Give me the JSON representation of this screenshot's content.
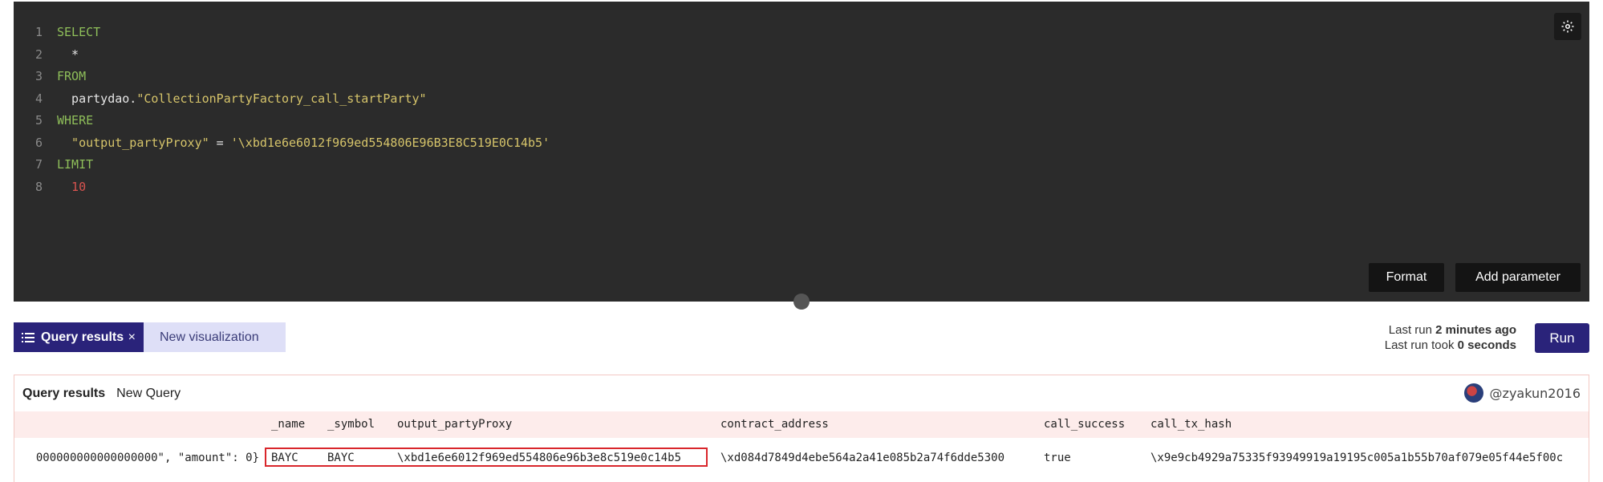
{
  "editor": {
    "lines": [
      {
        "no": "1",
        "tokens": [
          {
            "t": "SELECT",
            "c": "kw"
          }
        ]
      },
      {
        "no": "2",
        "tokens": [
          {
            "t": "  *",
            "c": "plain"
          }
        ]
      },
      {
        "no": "3",
        "tokens": [
          {
            "t": "FROM",
            "c": "kw"
          }
        ]
      },
      {
        "no": "4",
        "tokens": [
          {
            "t": "  partydao.",
            "c": "plain"
          },
          {
            "t": "\"CollectionPartyFactory_call_startParty\"",
            "c": "str"
          }
        ]
      },
      {
        "no": "5",
        "tokens": [
          {
            "t": "WHERE",
            "c": "kw"
          }
        ]
      },
      {
        "no": "6",
        "tokens": [
          {
            "t": "  \"output_partyProxy\"",
            "c": "str"
          },
          {
            "t": " = ",
            "c": "plain"
          },
          {
            "t": "'\\xbd1e6e6012f969ed554806E96B3E8C519E0C14b5'",
            "c": "str"
          }
        ]
      },
      {
        "no": "7",
        "tokens": [
          {
            "t": "LIMIT",
            "c": "kw"
          }
        ]
      },
      {
        "no": "8",
        "tokens": [
          {
            "t": "  10",
            "c": "num"
          }
        ]
      }
    ],
    "format_label": "Format",
    "add_parameter_label": "Add parameter",
    "settings_icon": "gear-icon"
  },
  "tabs": {
    "query_results": "Query results",
    "close": "×",
    "new_visualization": "New visualization"
  },
  "run": {
    "last_run_prefix": "Last run ",
    "last_run_value": "2 minutes ago",
    "took_prefix": "Last run took ",
    "took_value": "0 seconds",
    "label": "Run"
  },
  "results": {
    "title": "Query results",
    "query_name": "New Query",
    "user": "@zyakun2016",
    "columns": [
      "_name",
      "_symbol",
      "output_partyProxy",
      "contract_address",
      "call_success",
      "call_tx_hash"
    ],
    "row": {
      "truncated": "000000000000000000\", \"amount\": 0}",
      "_name": "BAYC",
      "_symbol": "BAYC",
      "output_partyProxy": "\\xbd1e6e6012f969ed554806e96b3e8c519e0c14b5",
      "contract_address": "\\xd084d7849d4ebe564a2a41e085b2a74f6dde5300",
      "call_success": "true",
      "call_tx_hash": "\\x9e9cb4929a75335f93949919a19195c005a1b55b70af079e05f44e5f00c"
    }
  },
  "colors": {
    "editor_bg": "#2b2b2b",
    "accent": "#2a237a",
    "highlight": "#d9262b"
  }
}
